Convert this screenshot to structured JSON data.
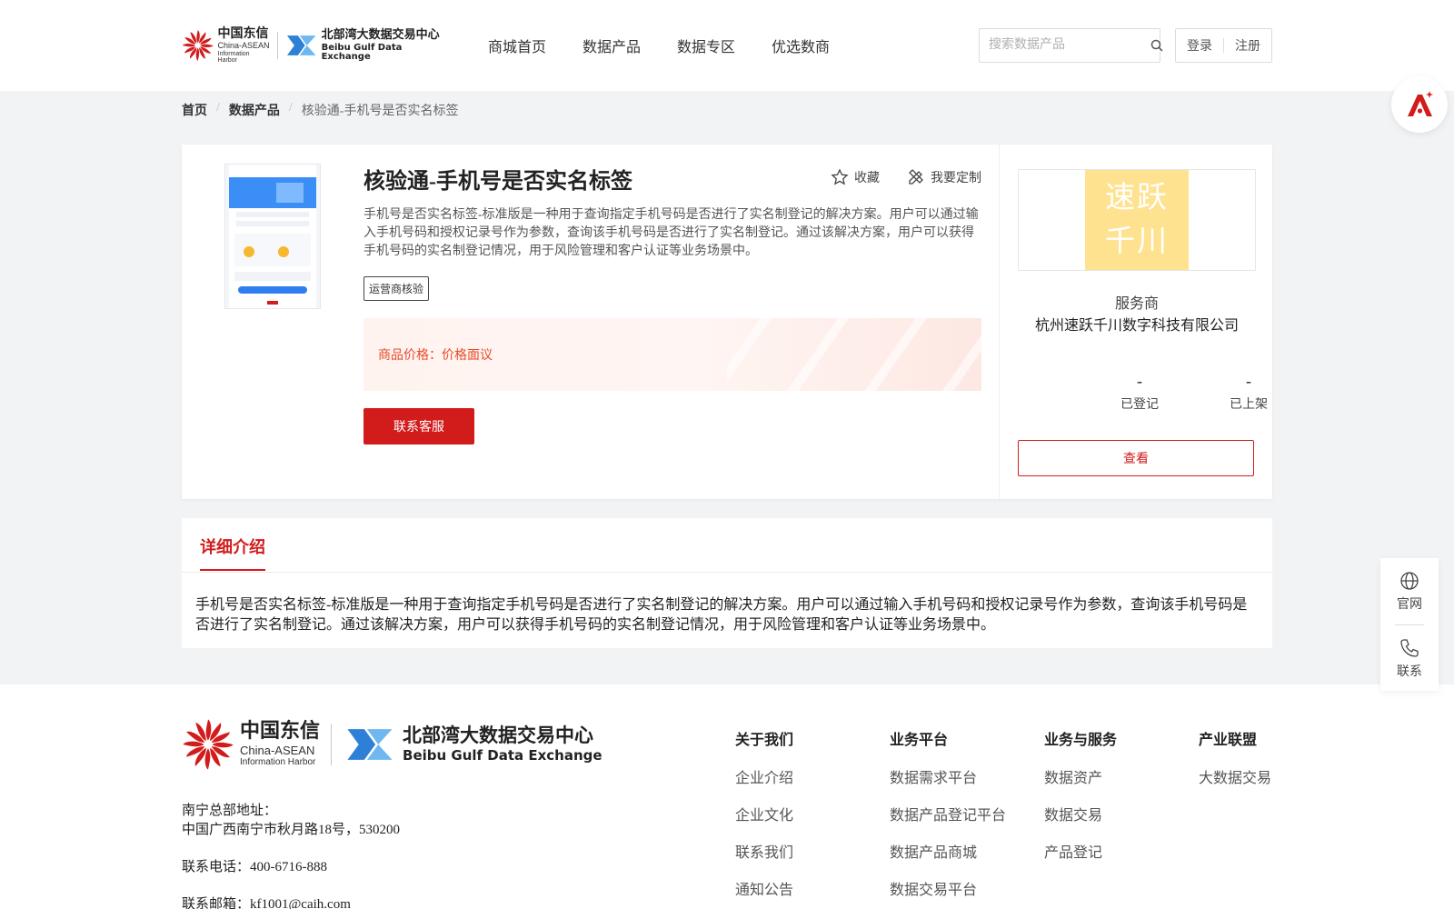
{
  "header": {
    "logo_a": {
      "cn": "中国东信",
      "en1": "China-ASEAN",
      "en2": "Information Harbor"
    },
    "logo_b": {
      "cn": "北部湾大数据交易中心",
      "en": "Beibu Gulf Data Exchange"
    },
    "nav": [
      "商城首页",
      "数据产品",
      "数据专区",
      "优选数商"
    ],
    "search_placeholder": "搜索数据产品",
    "login": "登录",
    "register": "注册"
  },
  "breadcrumb": {
    "home": "首页",
    "category": "数据产品",
    "current": "核验通-手机号是否实名标签"
  },
  "product": {
    "title": "核验通-手机号是否实名标签",
    "favorite": "收藏",
    "customize": "我要定制",
    "description": "手机号是否实名标签-标准版是一种用于查询指定手机号码是否进行了实名制登记的解决方案。用户可以通过输入手机号码和授权记录号作为参数，查询该手机号码是否进行了实名制登记。通过该解决方案，用户可以获得手机号码的实名制登记情况，用于风险管理和客户认证等业务场景中。",
    "tag": "运营商核验",
    "price_label": "商品价格：",
    "price_value": "价格面议",
    "contact_button": "联系客服"
  },
  "vendor": {
    "logo_line1": "速跃",
    "logo_line2": "千川",
    "label": "服务商",
    "name": "杭州速跃千川数字科技有限公司",
    "stats": [
      {
        "num": "-",
        "label": "已登记"
      },
      {
        "num": "-",
        "label": "已上架"
      }
    ],
    "view_button": "查看"
  },
  "detail": {
    "tab": "详细介绍",
    "text": "手机号是否实名标签-标准版是一种用于查询指定手机号码是否进行了实名制登记的解决方案。用户可以通过输入手机号码和授权记录号作为参数，查询该手机号码是否进行了实名制登记。通过该解决方案，用户可以获得手机号码的实名制登记情况，用于风险管理和客户认证等业务场景中。"
  },
  "side": {
    "website": "官网",
    "contact": "联系"
  },
  "footer": {
    "address_label": "南宁总部地址：",
    "address": "中国广西南宁市秋月路18号，530200",
    "phone": "联系电话：400-6716-888",
    "email": "联系邮箱：kf1001@caih.com",
    "columns": [
      {
        "head": "关于我们",
        "links": [
          "企业介绍",
          "企业文化",
          "联系我们",
          "通知公告"
        ]
      },
      {
        "head": "业务平台",
        "links": [
          "数据需求平台",
          "数据产品登记平台",
          "数据产品商城",
          "数据交易平台"
        ]
      },
      {
        "head": "业务与服务",
        "links": [
          "数据资产",
          "数据交易",
          "产品登记"
        ]
      },
      {
        "head": "产业联盟",
        "links": [
          "大数据交易"
        ]
      }
    ]
  },
  "colors": {
    "brand_red": "#d21b1b",
    "price_orange": "#e84b2b",
    "vendor_yellow": "#ffe28f",
    "page_gray": "#f2f3f5"
  }
}
